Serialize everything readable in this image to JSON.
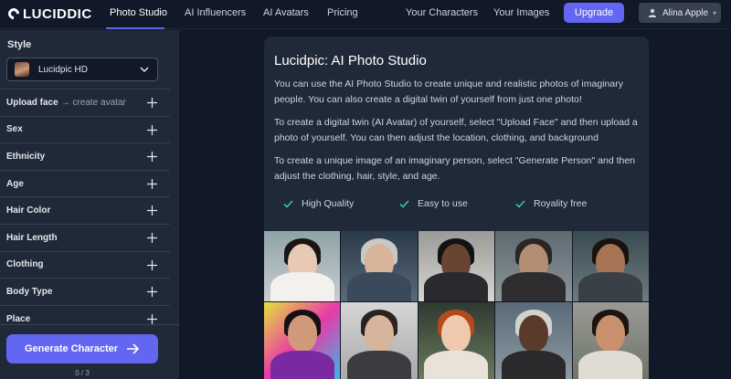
{
  "brand": {
    "name": "LUCIDDIC"
  },
  "nav": {
    "links": [
      "Photo Studio",
      "AI Influencers",
      "AI Avatars",
      "Pricing",
      "Your Characters",
      "Your Images"
    ],
    "active": "Photo Studio",
    "upgrade_label": "Upgrade",
    "user_name": "Alina Apple"
  },
  "sidebar": {
    "style_label": "Style",
    "style_value": "Lucidpic HD",
    "options": [
      {
        "label": "Upload face",
        "sub": "→ create avatar"
      },
      {
        "label": "Sex"
      },
      {
        "label": "Ethnicity"
      },
      {
        "label": "Age"
      },
      {
        "label": "Hair Color"
      },
      {
        "label": "Hair Length"
      },
      {
        "label": "Clothing"
      },
      {
        "label": "Body Type"
      },
      {
        "label": "Place"
      }
    ],
    "generate_label": "Generate Character",
    "counter": "0 / 3"
  },
  "main": {
    "title": "Lucidpic: AI Photo Studio",
    "paragraphs": [
      "You can use the AI Photo Studio to create unique and realistic photos of imaginary people. You can also create a digital twin of yourself from just one photo!",
      "To create a digital twin (AI Avatar) of yourself, select \"Upload Face\" and then upload a photo of yourself. You can then adjust the location, clothing, and background",
      "To create a unique image of an imaginary person, select \"Generate Person\" and then adjust the clothing, hair, style, and age."
    ],
    "features": [
      "High Quality",
      "Easy to use",
      "Royality free"
    ]
  },
  "colors": {
    "accent": "#6366f1",
    "check": "#34d399",
    "background": "#111827",
    "panel": "#1f2937"
  },
  "icons": [
    "logo-icon",
    "user-icon",
    "chevron-down-icon",
    "plus-icon",
    "arrow-right-icon",
    "check-icon"
  ]
}
